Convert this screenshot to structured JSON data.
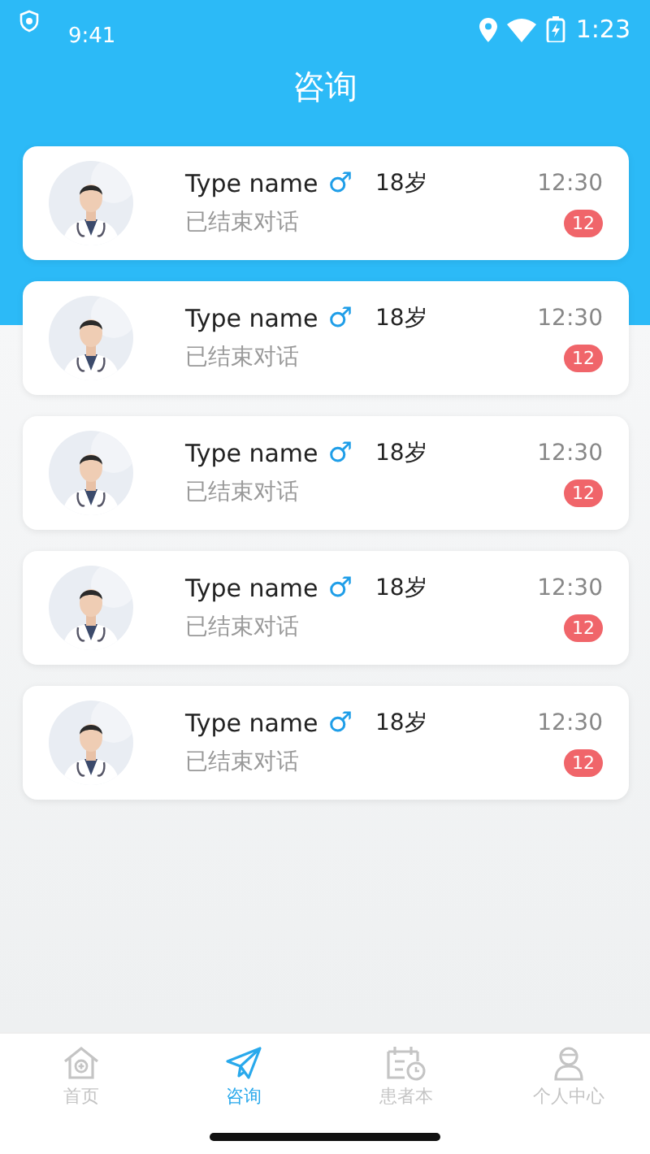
{
  "status_bar": {
    "time": "9:41",
    "clock_right": "1:23"
  },
  "header": {
    "title": "咨询"
  },
  "conversations": [
    {
      "name": "Type name",
      "gender": "♂",
      "age": "18岁",
      "status": "已结束对话",
      "time": "12:30",
      "unread": "12"
    },
    {
      "name": "Type name",
      "gender": "♂",
      "age": "18岁",
      "status": "已结束对话",
      "time": "12:30",
      "unread": "12"
    },
    {
      "name": "Type name",
      "gender": "♂",
      "age": "18岁",
      "status": "已结束对话",
      "time": "12:30",
      "unread": "12"
    },
    {
      "name": "Type name",
      "gender": "♂",
      "age": "18岁",
      "status": "已结束对话",
      "time": "12:30",
      "unread": "12"
    },
    {
      "name": "Type name",
      "gender": "♂",
      "age": "18岁",
      "status": "已结束对话",
      "time": "12:30",
      "unread": "12"
    }
  ],
  "tab_bar": [
    {
      "kind": "home",
      "label": "首页",
      "selected": false
    },
    {
      "kind": "send",
      "label": "咨询",
      "selected": true
    },
    {
      "kind": "calendar",
      "label": "患者本",
      "selected": false
    },
    {
      "kind": "person",
      "label": "个人中心",
      "selected": false
    }
  ]
}
